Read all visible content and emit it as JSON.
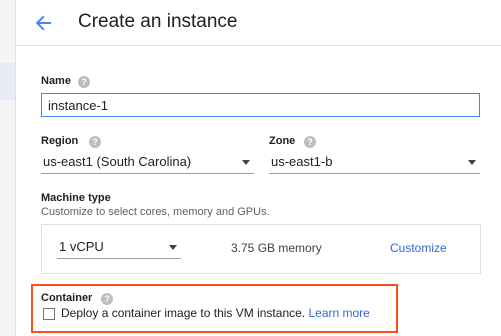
{
  "header": {
    "title": "Create an instance",
    "back_icon": "arrow-back-icon"
  },
  "form": {
    "name": {
      "label": "Name",
      "value": "instance-1",
      "help_icon": "help-icon"
    },
    "region": {
      "label": "Region",
      "selected": "us-east1 (South Carolina)"
    },
    "zone": {
      "label": "Zone",
      "selected": "us-east1-b"
    },
    "machine_type": {
      "label": "Machine type",
      "description": "Customize to select cores, memory and GPUs.",
      "cores_selected": "1 vCPU",
      "memory": "3.75 GB memory",
      "customize_label": "Customize"
    },
    "container": {
      "label": "Container",
      "checkbox_label": "Deploy a container image to this VM instance.",
      "checked": false,
      "learn_more": "Learn more"
    }
  },
  "colors": {
    "accent": "#4285f4",
    "link": "#3367d6",
    "highlight_border": "#f4511e"
  }
}
